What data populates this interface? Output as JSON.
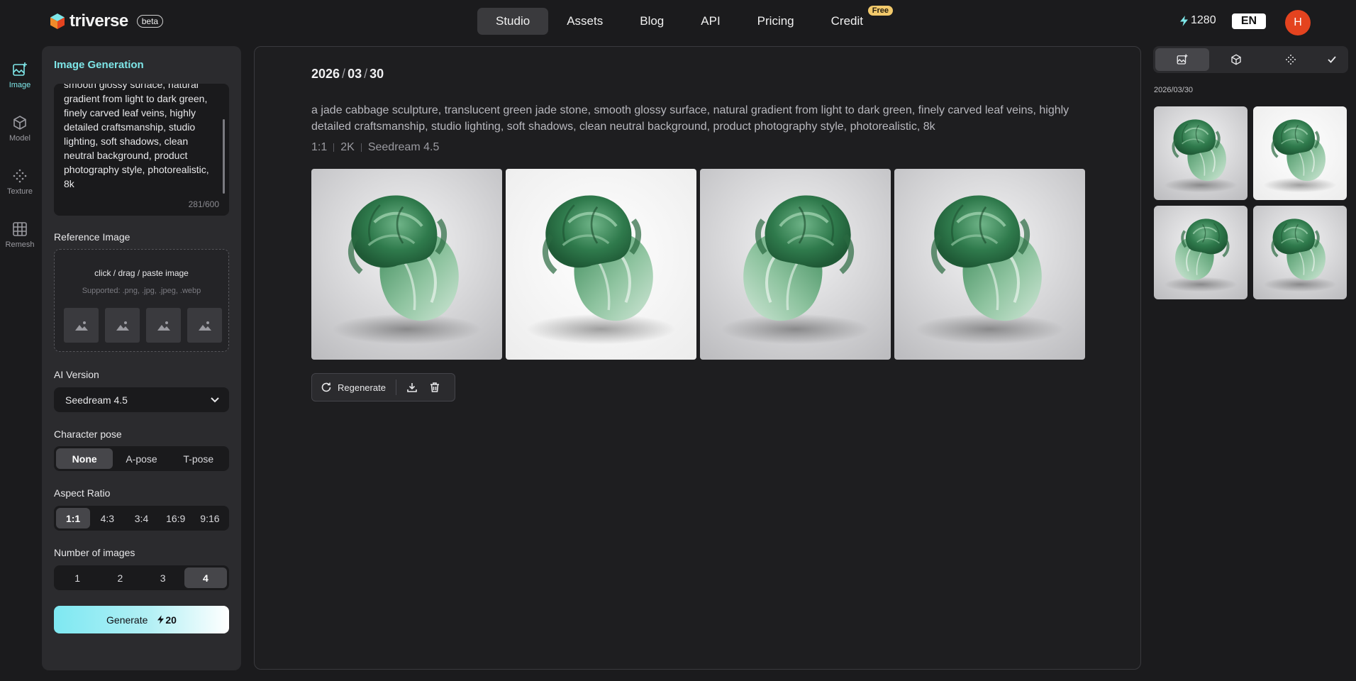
{
  "brand": {
    "name": "triverse",
    "badge": "beta"
  },
  "nav": {
    "items": [
      {
        "label": "Studio",
        "active": true
      },
      {
        "label": "Assets",
        "active": false
      },
      {
        "label": "Blog",
        "active": false
      },
      {
        "label": "API",
        "active": false
      },
      {
        "label": "Pricing",
        "active": false
      },
      {
        "label": "Credit",
        "active": false,
        "badge": "Free"
      }
    ]
  },
  "header": {
    "credits": "1280",
    "language": "EN",
    "avatar_initial": "H"
  },
  "rail": [
    {
      "label": "Image",
      "icon": "image-add-icon",
      "active": true
    },
    {
      "label": "Model",
      "icon": "cube-icon",
      "active": false
    },
    {
      "label": "Texture",
      "icon": "texture-dots-icon",
      "active": false
    },
    {
      "label": "Remesh",
      "icon": "grid-icon",
      "active": false
    }
  ],
  "panel": {
    "title": "Image Generation",
    "prompt_visible": "smooth glossy surface, natural gradient from light to dark green, finely carved leaf veins, highly detailed craftsmanship, studio lighting, soft shadows, clean neutral background, product photography style, photorealistic, 8k",
    "prompt_count": "281/600",
    "reference": {
      "label": "Reference Image",
      "main": "click / drag / paste image",
      "sub": "Supported: .png, .jpg, .jpeg, .webp"
    },
    "ai_version": {
      "label": "AI Version",
      "value": "Seedream 4.5"
    },
    "pose": {
      "label": "Character pose",
      "options": [
        "None",
        "A-pose",
        "T-pose"
      ],
      "selected": "None"
    },
    "aspect": {
      "label": "Aspect Ratio",
      "options": [
        "1:1",
        "4:3",
        "3:4",
        "16:9",
        "9:16"
      ],
      "selected": "1:1"
    },
    "count": {
      "label": "Number of images",
      "options": [
        "1",
        "2",
        "3",
        "4"
      ],
      "selected": "4"
    },
    "generate": {
      "label": "Generate",
      "cost": "20"
    }
  },
  "main": {
    "date": {
      "y": "2026",
      "m": "03",
      "d": "30"
    },
    "prompt": "a jade cabbage sculpture, translucent green jade stone, smooth glossy surface, natural gradient from light to dark green, finely carved leaf veins, highly detailed craftsmanship, studio lighting, soft shadows, clean neutral background, product photography style, photorealistic, 8k",
    "meta": [
      "1:1",
      "2K",
      "Seedream 4.5"
    ],
    "actions": {
      "regenerate": "Regenerate"
    }
  },
  "history": {
    "date": "2026/03/30"
  },
  "colors": {
    "accent": "#7ee6e8",
    "avatar": "#e4431f",
    "free_badge": "#f2c96b",
    "jade": "#3f8a5c"
  }
}
